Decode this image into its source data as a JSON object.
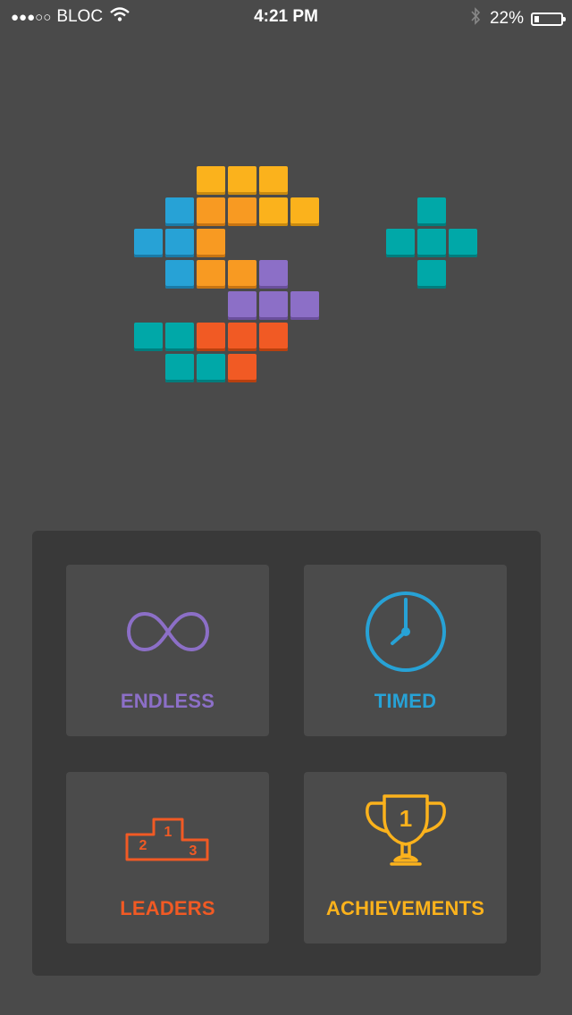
{
  "status_bar": {
    "signal": "●●●○○",
    "carrier": "BLOC",
    "time": "4:21 PM",
    "battery": "22%"
  },
  "colors": {
    "background": "#4a4a4a",
    "panel": "#393939",
    "tile": "#4b4b4b",
    "purple": "#8c6fc7",
    "blue": "#27a2d6",
    "orange_red": "#f15a24",
    "yellow": "#fbb21c",
    "amber": "#f89a22",
    "teal": "#00a8a8"
  },
  "menu": {
    "endless": {
      "label": "ENDLESS",
      "icon": "infinity-icon"
    },
    "timed": {
      "label": "TIMED",
      "icon": "clock-icon"
    },
    "leaders": {
      "label": "LEADERS",
      "icon": "podium-icon",
      "places": [
        "1",
        "2",
        "3"
      ]
    },
    "achievements": {
      "label": "ACHIEVEMENTS",
      "icon": "trophy-icon",
      "number": "1"
    }
  }
}
